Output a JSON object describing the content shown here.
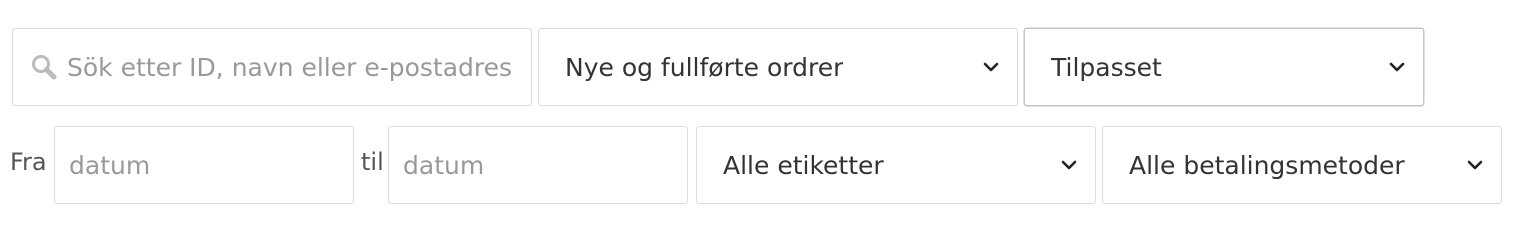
{
  "search": {
    "placeholder": "Sök etter ID, navn eller e-postadresse",
    "icon": "search-icon"
  },
  "order_status_select": {
    "selected": "Nye og fullførte ordrer",
    "icon": "chevron-down-icon"
  },
  "period_select": {
    "selected": "Tilpasset",
    "icon": "chevron-down-icon"
  },
  "date_range": {
    "from_label": "Fra",
    "from_placeholder": "datum",
    "to_label": "til",
    "to_placeholder": "datum"
  },
  "tag_select": {
    "selected": "Alle etiketter",
    "icon": "chevron-down-icon"
  },
  "payment_method_select": {
    "selected": "Alle betalingsmetoder",
    "icon": "chevron-down-icon"
  },
  "colors": {
    "border": "#dddddd",
    "text": "#333333",
    "placeholder": "#999999",
    "icon": "#bbbbbb"
  }
}
